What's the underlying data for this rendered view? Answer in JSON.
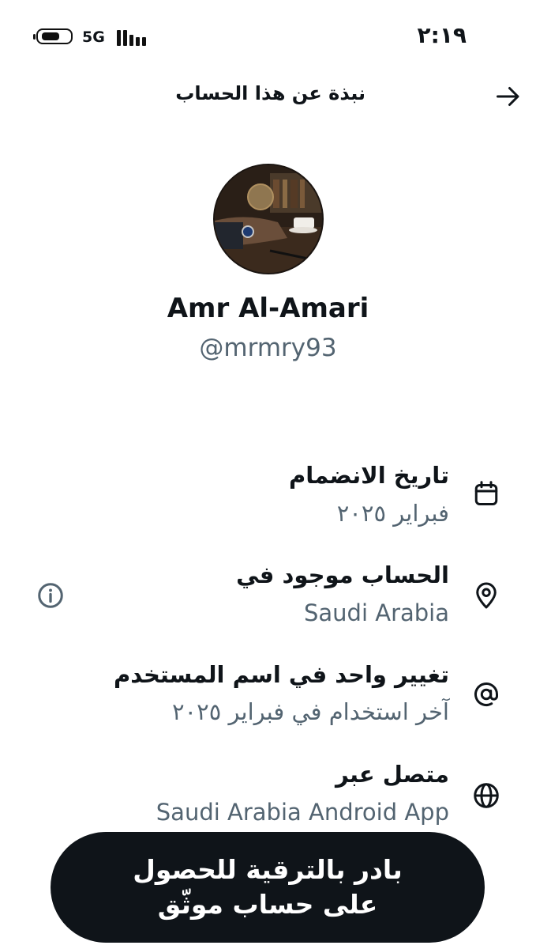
{
  "status_bar": {
    "network": "5G",
    "time": "٢:١٩",
    "icons": [
      "battery-icon",
      "signal-icon"
    ]
  },
  "header": {
    "title": "نبذة عن هذا الحساب",
    "back_icon": "arrow-right-icon"
  },
  "profile": {
    "display_name": "Amr Al-Amari",
    "handle": "@mrmry93"
  },
  "info_rows": [
    {
      "icon": "calendar-icon",
      "title": "تاريخ الانضمام",
      "value": "فبراير ٢٠٢٥"
    },
    {
      "icon": "location-pin-icon",
      "title": "الحساب موجود في",
      "value": "Saudi Arabia",
      "extra_icon": "info-icon"
    },
    {
      "icon": "at-sign-icon",
      "title": "تغيير واحد في اسم المستخدم",
      "value": "آخر استخدام في فبراير ٢٠٢٥"
    },
    {
      "icon": "globe-icon",
      "title": "متصل عبر",
      "value": "Saudi Arabia Android App"
    }
  ],
  "upgrade_button": {
    "label": "بادر بالترقية للحصول على حساب موثّق"
  },
  "colors": {
    "text_primary": "#0f1419",
    "text_secondary": "#536471",
    "button_bg": "#0f1419",
    "button_text": "#ffffff"
  }
}
